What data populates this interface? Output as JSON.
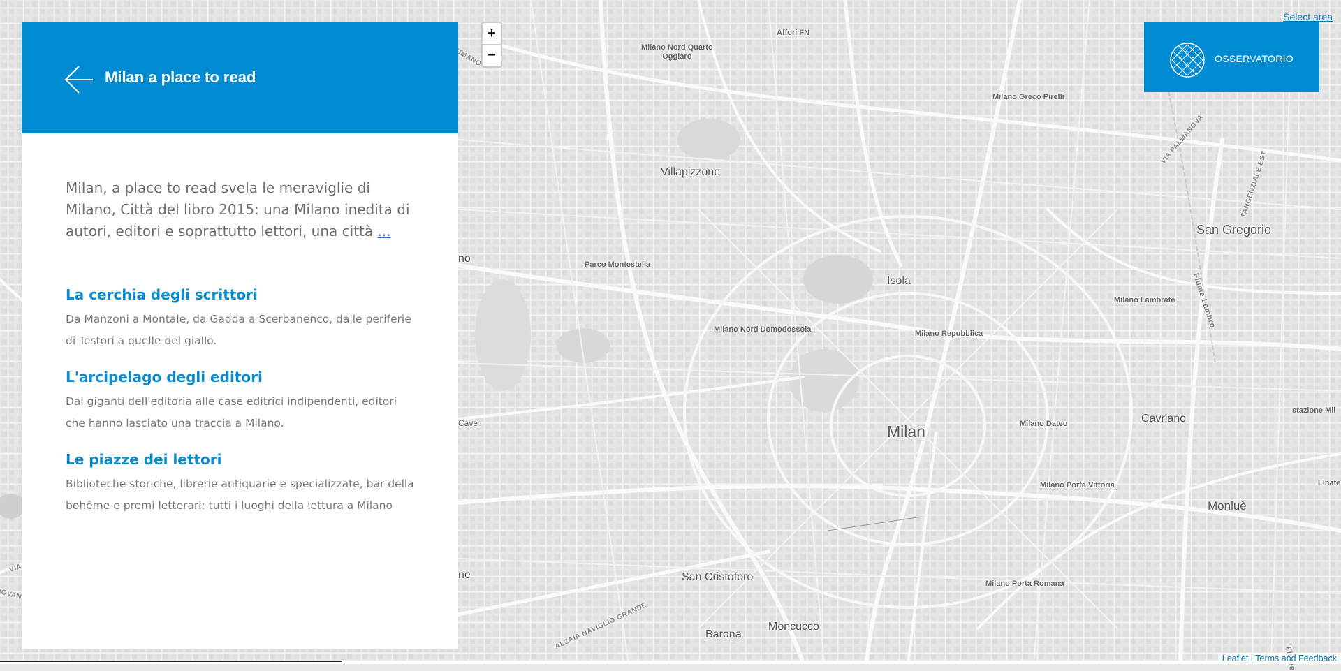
{
  "sidebar": {
    "title": "Milan a place to read",
    "intro": "Milan, a place to read svela le meraviglie di Milano, Città del libro 2015: una Milano inedita di autori, editori e soprattutto lettori, una città",
    "more": "...",
    "sections": [
      {
        "title": "La cerchia degli scrittori",
        "desc": "Da Manzoni a Montale, da Gadda a Scerbanenco, dalle periferie di Testori a quelle del giallo."
      },
      {
        "title": "L'arcipelago degli editori",
        "desc": "Dai giganti dell'editoria alle case editrici indipendenti, editori che hanno lasciato una traccia a Milano."
      },
      {
        "title": "Le piazze dei lettori",
        "desc": "Biblioteche storiche, librerie antiquarie e specializzate, bar della bohême e premi letterari: tutti i luoghi della lettura a Milano"
      }
    ]
  },
  "map": {
    "zoom_in": "+",
    "zoom_out": "−",
    "select_area": "Select area",
    "places": {
      "affori": "Affori FN",
      "quarto_oggiaro": "Milano Nord Quarto\nOggiaro",
      "greco_pirelli": "Milano Greco Pirelli",
      "villapizzone": "Villapizzone",
      "san_gregorio": "San Gregorio",
      "parco_montestella": "Parco Montestella",
      "isola": "Isola",
      "lambrate": "Milano Lambrate",
      "domodossola": "Milano Nord Domodossola",
      "repubblica": "Milano Repubblica",
      "milan": "Milan",
      "dateo": "Milano Dateo",
      "cavriano": "Cavriano",
      "stazione_milano": "stazione Mil",
      "porta_vittoria": "Milano Porta Vittoria",
      "monlue": "Monluè",
      "linate": "Linate",
      "san_cristoforo": "San Cristoforo",
      "porta_romana": "Milano Porta Romana",
      "moncucco": "Moncucco",
      "barona": "Barona",
      "cave": "Cave",
      "no_fragment": "no",
      "ne_fragment": "ne",
      "via_palmanova": "VIA PALMANOVA",
      "tangenziale_est": "TANGENZIALE EST",
      "fiume_lambro": "Fiume Lambro",
      "alzaia_naviglio": "ALZAIA NAVIGLIO GRANDE",
      "umano": "UMANO",
      "via_fragment": "VIA",
      "jovan_fragment": "IOVAN",
      "fiume_fragment": "Fiume"
    }
  },
  "osservatorio": {
    "label": "OSSERVATORIO"
  },
  "attribution": {
    "leaflet": "Leaflet",
    "separator": " | ",
    "terms": "Terms and Feedback"
  },
  "colors": {
    "accent": "#008bd3",
    "link": "#0a8bcb"
  }
}
